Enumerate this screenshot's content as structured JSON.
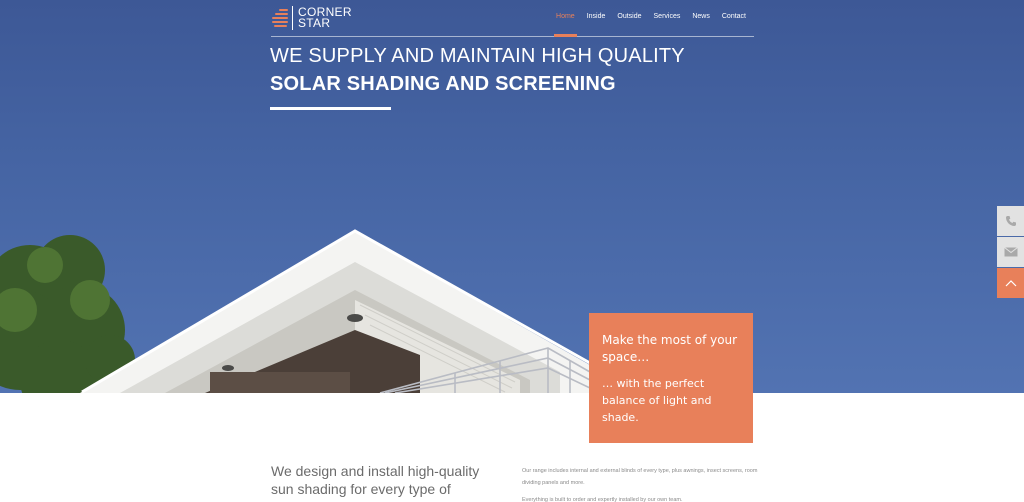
{
  "header": {
    "logo_line1": "CORNER",
    "logo_line2": "STAR",
    "nav": [
      {
        "label": "Home",
        "active": true
      },
      {
        "label": "Inside",
        "active": false
      },
      {
        "label": "Outside",
        "active": false
      },
      {
        "label": "Services",
        "active": false
      },
      {
        "label": "News",
        "active": false
      },
      {
        "label": "Contact",
        "active": false
      }
    ]
  },
  "hero": {
    "headline_line1": "WE SUPPLY AND MAINTAIN HIGH QUALITY",
    "headline_line2": "SOLAR SHADING AND SCREENING"
  },
  "side_tabs": [
    {
      "icon": "phone-icon"
    },
    {
      "icon": "mail-icon"
    },
    {
      "icon": "chevron-up-icon"
    }
  ],
  "callout": {
    "title": "Make the most of your space…",
    "body": "… with the perfect balance of light and shade."
  },
  "content": {
    "intro": "We design and install high-quality sun shading for every type of",
    "paragraph1": "Our range includes internal and external blinds of every type, plus awnings, insect screens, room dividing panels and more.",
    "paragraph2": "Everything is built to order and expertly installed by our own team."
  },
  "colors": {
    "accent": "#e8805a",
    "sky": "#4564a3",
    "side_tab_gray": "#e2e2e2"
  }
}
